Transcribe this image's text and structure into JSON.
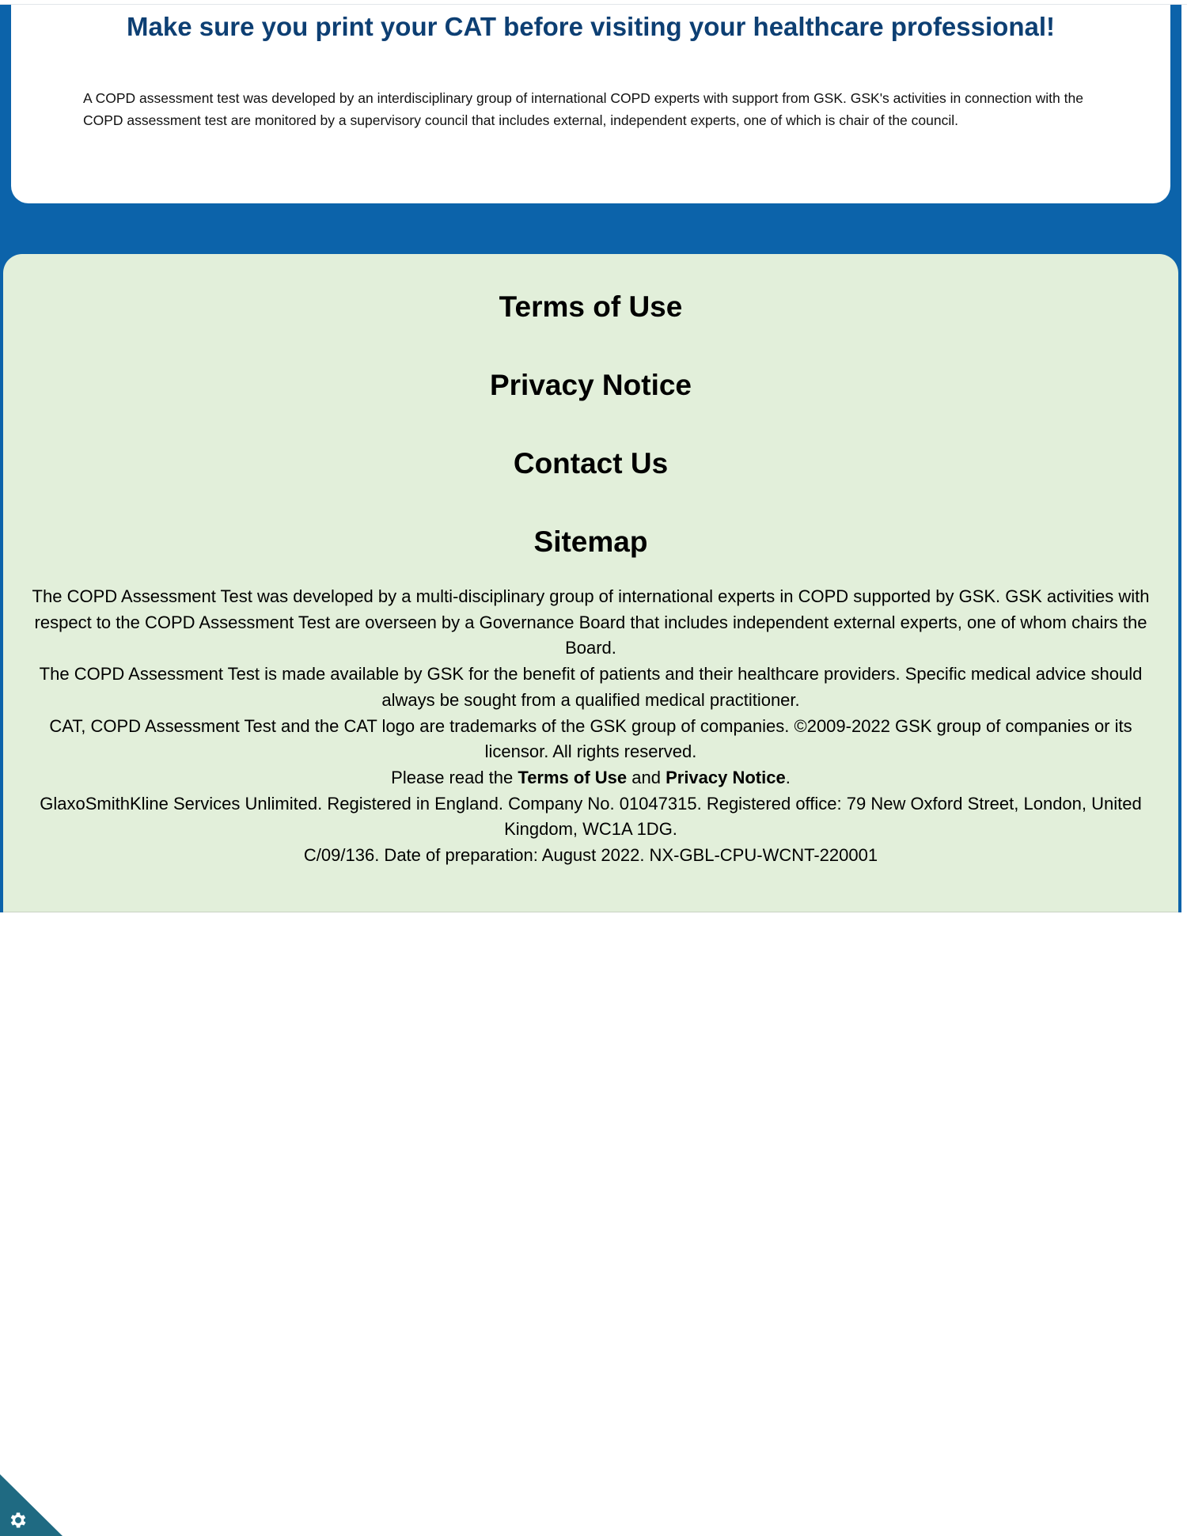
{
  "info": {
    "title": "Make sure you print your CAT before visiting your healthcare professional!",
    "text": "A COPD assessment test was developed by an interdisciplinary group of international COPD experts with support from GSK. GSK's activities in connection with the COPD assessment test are monitored by a supervisory council that includes external, independent experts, one of which is chair of the council."
  },
  "footer": {
    "links": [
      "Terms of Use",
      "Privacy Notice",
      "Contact Us",
      "Sitemap"
    ],
    "legal": {
      "p1": "The COPD Assessment Test was developed by a multi-disciplinary group of international experts in COPD supported by GSK. GSK activities with respect to the COPD Assessment Test are overseen by a Governance Board that includes independent external experts, one of whom chairs the Board.",
      "p2": "The COPD Assessment Test is made available by GSK for the benefit of patients and their healthcare providers.   Specific medical advice should always be sought from a qualified medical practitioner.",
      "p3": "CAT, COPD Assessment Test and the CAT logo are trademarks of the GSK group of companies. ©2009-2022 GSK group of companies or its licensor. All rights reserved.",
      "p4_prefix": "Please read the ",
      "p4_link1": "Terms of Use",
      "p4_middle": " and ",
      "p4_link2": "Privacy Notice",
      "p4_suffix": ".",
      "p5": "GlaxoSmithKline Services Unlimited. Registered in England. Company No. 01047315. Registered office: 79 New Oxford Street, London, United Kingdom, WC1A 1DG.",
      "p6": "C/09/136. Date of preparation: August 2022. NX-GBL-CPU-WCNT-220001"
    }
  },
  "cookie_settings": {
    "icon": "gear-icon"
  },
  "colors": {
    "band_blue": "#0c63aa",
    "title_navy": "#0d3f73",
    "footer_green": "#e2efda",
    "cookie_teal": "#1f6a82"
  }
}
